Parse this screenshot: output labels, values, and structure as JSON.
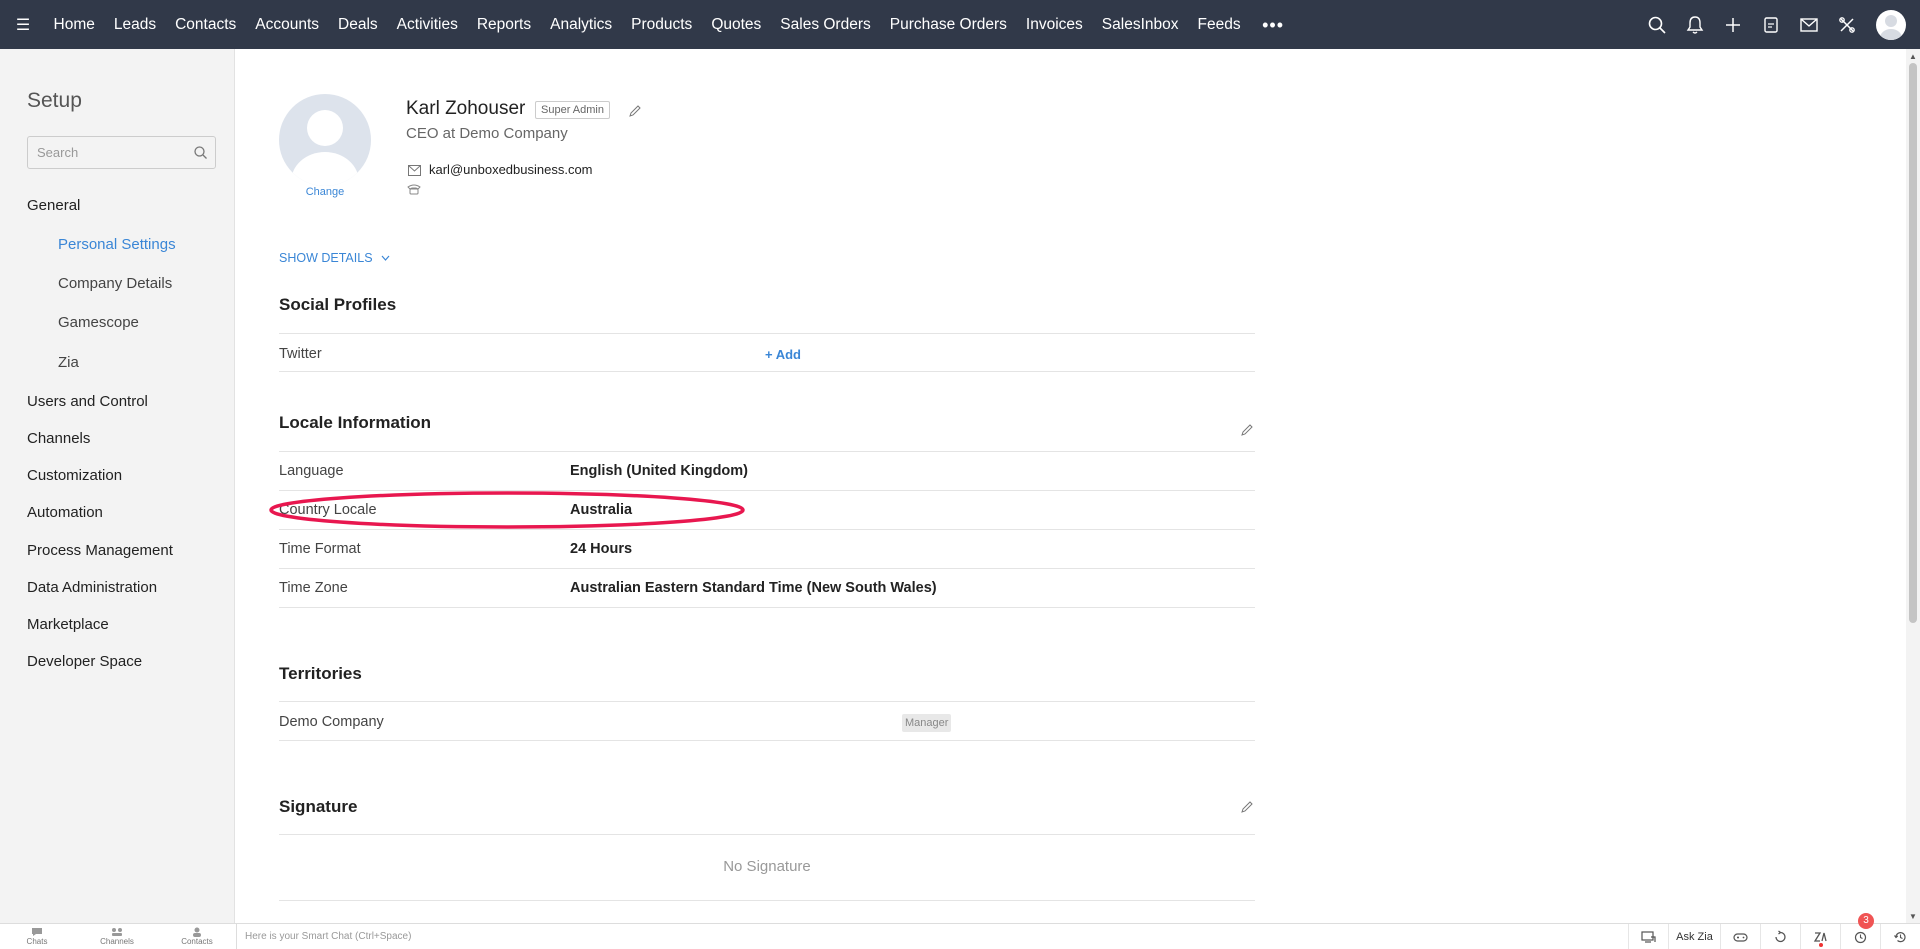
{
  "nav": {
    "items": [
      "Home",
      "Leads",
      "Contacts",
      "Accounts",
      "Deals",
      "Activities",
      "Reports",
      "Analytics",
      "Products",
      "Quotes",
      "Sales Orders",
      "Purchase Orders",
      "Invoices",
      "SalesInbox",
      "Feeds"
    ],
    "more": "•••",
    "icons": [
      "search-icon",
      "bell-icon",
      "plus-icon",
      "calendar-icon",
      "mail-icon",
      "tools-icon"
    ]
  },
  "sidebar": {
    "title": "Setup",
    "search_placeholder": "Search",
    "general": "General",
    "general_items": [
      "Personal Settings",
      "Company Details",
      "Gamescope",
      "Zia"
    ],
    "sections": [
      "Users and Control",
      "Channels",
      "Customization",
      "Automation",
      "Process Management",
      "Data Administration",
      "Marketplace",
      "Developer Space"
    ]
  },
  "profile": {
    "change": "Change",
    "name": "Karl Zohouser",
    "role": "Super Admin",
    "title": "CEO at Demo Company",
    "email": "karl@unboxedbusiness.com",
    "show_details": "SHOW DETAILS"
  },
  "social": {
    "title": "Social Profiles",
    "rows": [
      {
        "label": "Twitter",
        "action": "+ Add"
      }
    ]
  },
  "locale": {
    "title": "Locale Information",
    "rows": [
      {
        "label": "Language",
        "value": "English (United Kingdom)"
      },
      {
        "label": "Country Locale",
        "value": "Australia"
      },
      {
        "label": "Time Format",
        "value": "24 Hours"
      },
      {
        "label": "Time Zone",
        "value": "Australian Eastern Standard Time (New South Wales)"
      }
    ]
  },
  "territories": {
    "title": "Territories",
    "rows": [
      {
        "label": "Demo Company",
        "badge": "Manager"
      }
    ]
  },
  "signature": {
    "title": "Signature",
    "empty": "No Signature"
  },
  "bottombar": {
    "tabs": [
      "Chats",
      "Channels",
      "Contacts"
    ],
    "smart_chat": "Here is your Smart Chat (Ctrl+Space)",
    "ask_zia": "Ask Zia",
    "notification_count": "3"
  },
  "colors": {
    "topbar": "#313949",
    "accent": "#3a86d6",
    "annotation": "#e8174f",
    "badge": "#f05454"
  }
}
